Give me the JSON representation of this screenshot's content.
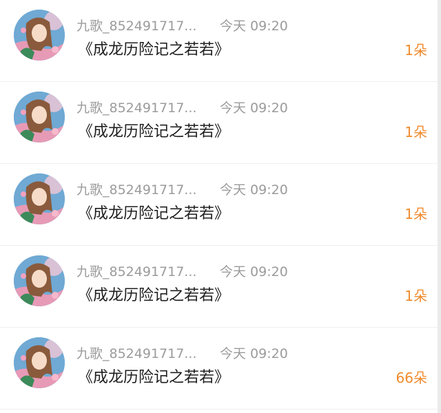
{
  "gifts": [
    {
      "username": "九歌_852491717...",
      "time": "今天 09:20",
      "title": "《成龙历险记之若若》",
      "count": "1朵"
    },
    {
      "username": "九歌_852491717...",
      "time": "今天 09:20",
      "title": "《成龙历险记之若若》",
      "count": "1朵"
    },
    {
      "username": "九歌_852491717...",
      "time": "今天 09:20",
      "title": "《成龙历险记之若若》",
      "count": "1朵"
    },
    {
      "username": "九歌_852491717...",
      "time": "今天 09:20",
      "title": "《成龙历险记之若若》",
      "count": "1朵"
    },
    {
      "username": "九歌_852491717...",
      "time": "今天 09:20",
      "title": "《成龙历险记之若若》",
      "count": "66朵"
    }
  ],
  "colors": {
    "count_accent": "#f08a2c",
    "meta_text": "#9b9b9b",
    "title_text": "#1e1e1e"
  },
  "icons": {
    "avatar": "anime-girl-avatar"
  }
}
